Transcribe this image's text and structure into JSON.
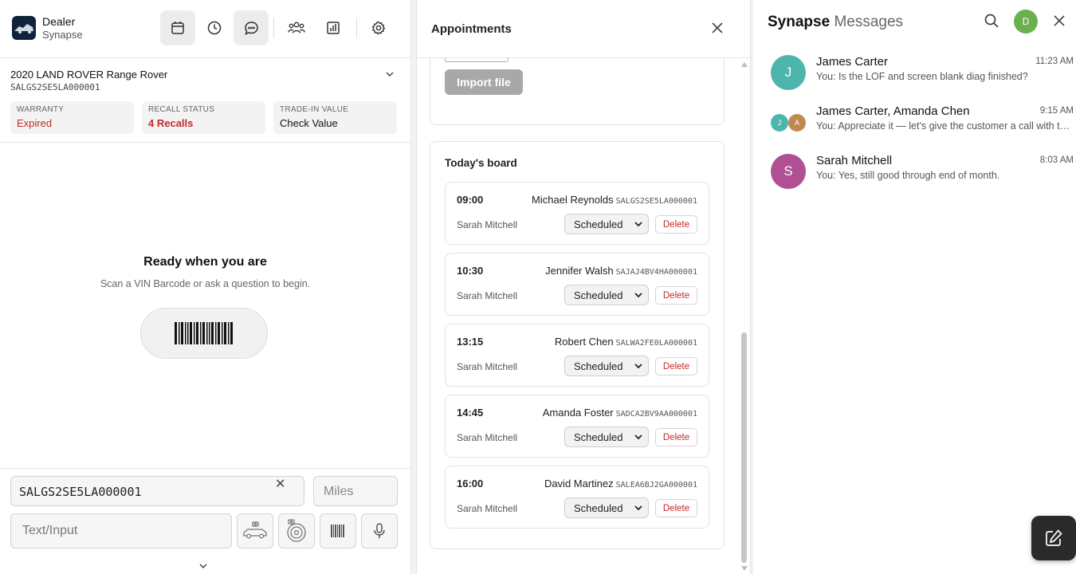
{
  "app": {
    "brand_line1": "Dealer",
    "brand_line2": "Synapse"
  },
  "toolbar": {
    "icons": [
      "calendar-icon",
      "clock-icon",
      "chat-icon",
      "people-icon",
      "chart-icon",
      "settings-icon"
    ],
    "active": [
      "calendar-icon",
      "chat-icon"
    ]
  },
  "vehicle": {
    "title": "2020 LAND ROVER Range Rover",
    "vin": "SALGS2SE5LA000001",
    "stats": [
      {
        "label": "WARRANTY",
        "value": "Expired",
        "color": "#c62828"
      },
      {
        "label": "RECALL STATUS",
        "value": "4 Recalls",
        "color": "#c62828"
      },
      {
        "label": "TRADE-IN VALUE",
        "value": "Check Value",
        "color": "#111111"
      }
    ]
  },
  "empty_state": {
    "title": "Ready when you are",
    "subtitle": "Scan a VIN Barcode or ask a question to begin."
  },
  "inputs": {
    "vin_value": "SALGS2SE5LA000001",
    "clear_symbol": "✕",
    "miles_placeholder": "Miles",
    "text_placeholder": "Text/Input"
  },
  "appointments": {
    "title": "Appointments",
    "import_label": "Import file",
    "board_title": "Today's board",
    "items": [
      {
        "time": "09:00",
        "customer": "Michael Reynolds",
        "vin": "SALGS2SE5LA000001",
        "advisor": "Sarah Mitchell",
        "status": "Scheduled",
        "delete": "Delete"
      },
      {
        "time": "10:30",
        "customer": "Jennifer Walsh",
        "vin": "SAJAJ4BV4HA000001",
        "advisor": "Sarah Mitchell",
        "status": "Scheduled",
        "delete": "Delete"
      },
      {
        "time": "13:15",
        "customer": "Robert Chen",
        "vin": "SALWA2FE0LA000001",
        "advisor": "Sarah Mitchell",
        "status": "Scheduled",
        "delete": "Delete"
      },
      {
        "time": "14:45",
        "customer": "Amanda Foster",
        "vin": "SADCA2BV9AA000001",
        "advisor": "Sarah Mitchell",
        "status": "Scheduled",
        "delete": "Delete"
      },
      {
        "time": "16:00",
        "customer": "David Martinez",
        "vin": "SALEA6BJ2GA000001",
        "advisor": "Sarah Mitchell",
        "status": "Scheduled",
        "delete": "Delete"
      }
    ]
  },
  "messages": {
    "title_bold": "Synapse",
    "title_rest": "Messages",
    "user_initial": "D",
    "user_color": "#6ab04c",
    "conversations": [
      {
        "name": "James Carter",
        "time": "11:23 AM",
        "preview": "You: Is the LOF and screen blank diag finished?",
        "avatars": [
          {
            "initial": "J",
            "color": "#4db6ac"
          }
        ]
      },
      {
        "name": "James Carter, Amanda Chen",
        "time": "9:15 AM",
        "preview": "You: Appreciate it — let's give the customer a call with the update before noon.",
        "avatars": [
          {
            "initial": "J",
            "color": "#4db6ac"
          },
          {
            "initial": "A",
            "color": "#c08a4f"
          }
        ]
      },
      {
        "name": "Sarah Mitchell",
        "time": "8:03 AM",
        "preview": "You: Yes, still good through end of month.",
        "avatars": [
          {
            "initial": "S",
            "color": "#b04f92"
          }
        ]
      }
    ]
  }
}
